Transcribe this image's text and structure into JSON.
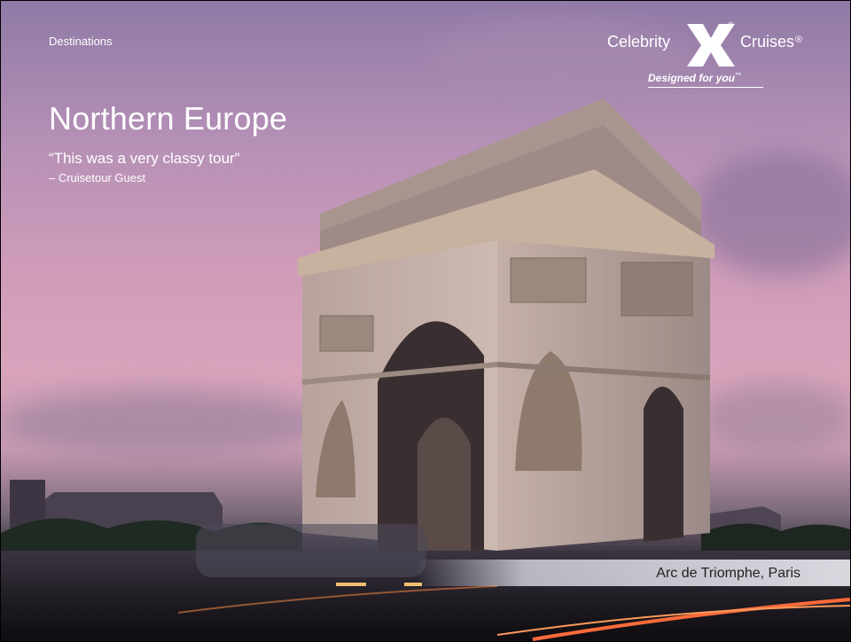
{
  "slide": {
    "section_label": "Destinations",
    "title": "Northern Europe",
    "quote": "“This was a very classy tour”",
    "attribution": "– Cruisetour Guest",
    "caption": "Arc de Triomphe, Paris"
  },
  "logo": {
    "brand_left": "Celebrity",
    "brand_right": "Cruises",
    "registered_mark": "®",
    "tagline": "Designed for you",
    "trademark": "™",
    "emblem": "x-emblem-icon"
  },
  "colors": {
    "sky_top": "#8f7aa6",
    "sky_mid": "#cf9cb9",
    "stone": "#c9b6ad",
    "text": "#ffffff",
    "caption_text": "#222222"
  }
}
